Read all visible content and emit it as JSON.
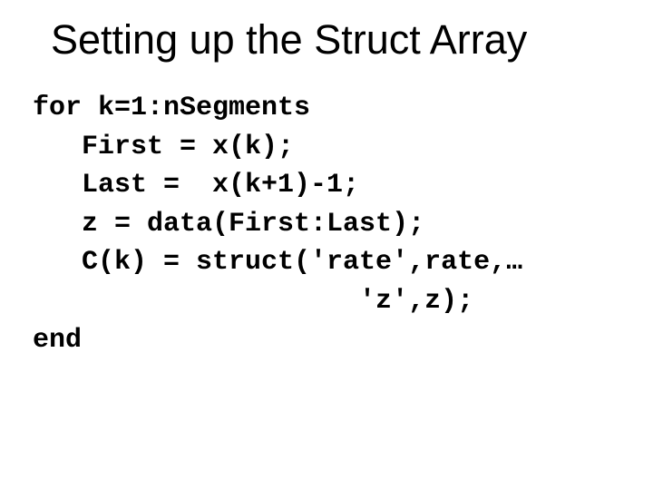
{
  "title": "Setting up the Struct Array",
  "code": {
    "l1": "for k=1:nSegments",
    "l2": "   First = x(k);",
    "l3": "   Last =  x(k+1)-1;",
    "l4": "   z = data(First:Last);",
    "l5": "   C(k) = struct('rate',rate,…",
    "l6": "                    'z',z);",
    "l7": "end"
  }
}
